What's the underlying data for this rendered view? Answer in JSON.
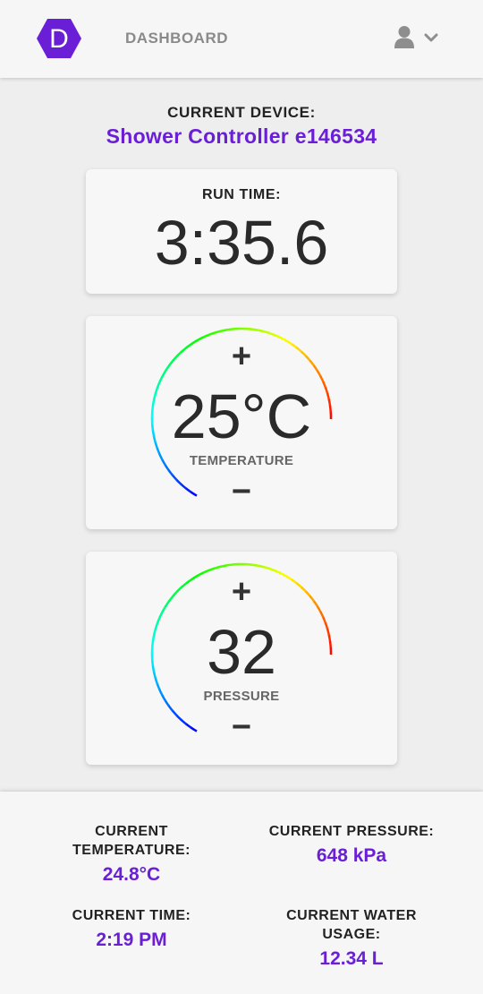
{
  "colors": {
    "accent": "#6a1fd6",
    "logo": "#6a1fd6"
  },
  "header": {
    "logo_letter": "D",
    "nav_title": "DASHBOARD",
    "user_icon": "user-icon",
    "menu_icon": "chevron-down-icon"
  },
  "device": {
    "label": "CURRENT DEVICE:",
    "name": "Shower Controller e146534"
  },
  "run_time": {
    "label": "RUN TIME:",
    "value": "3:35.6"
  },
  "temperature_dial": {
    "increase_label": "+",
    "value": "25°C",
    "label": "TEMPERATURE",
    "decrease_label": "−"
  },
  "pressure_dial": {
    "increase_label": "+",
    "value": "32",
    "label": "PRESSURE",
    "decrease_label": "−"
  },
  "stats": {
    "temperature": {
      "label_line1": "CURRENT",
      "label_line2": "TEMPERATURE:",
      "value": "24.8°C"
    },
    "pressure": {
      "label": "CURRENT PRESSURE:",
      "value": "648 kPa"
    },
    "time": {
      "label": "CURRENT TIME:",
      "value": "2:19 PM"
    },
    "water": {
      "label_line1": "CURRENT WATER",
      "label_line2": "USAGE:",
      "value": "12.34 L"
    }
  }
}
